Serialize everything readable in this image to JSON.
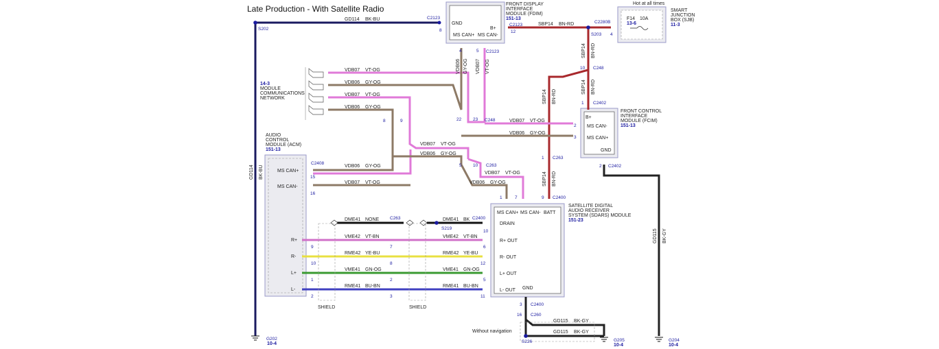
{
  "title": "Late Production - With Satellite Radio",
  "colors": {
    "vt_og": "#e07ad8",
    "gy_og": "#8d7a66",
    "bn_rd": "#a8282c",
    "bk_bu": "#1a1a60",
    "bk": "#111111",
    "vt_bn": "#d070c8",
    "ye_bu": "#e8e040",
    "gn_og": "#3a9a30",
    "bu_bn": "#4040c0",
    "bk_gy": "#222222"
  },
  "modules": {
    "fdim": {
      "name": "FRONT DISPLAY",
      "line2": "INTERFACE",
      "line3": "MODULE (FDIM)",
      "ref": "151-13",
      "pin_gnd": "GND",
      "pin_bplus": "B+",
      "pin_can_p": "MS CAN+",
      "pin_can_m": "MS CAN-"
    },
    "sjb": {
      "note": "Hot at all times",
      "name": "SMART",
      "line2": "JUNCTION",
      "line3": "BOX (SJB)",
      "ref": "11-3",
      "fuse": "F14",
      "amp": "10A",
      "fuse_ref": "13-6"
    },
    "fcim": {
      "name": "FRONT CONTROL",
      "line2": "INTERFACE",
      "line3": "MODULE (FCIM)",
      "ref": "151-13",
      "pin_bplus": "B+",
      "pin_can_m": "MS CAN-",
      "pin_can_p": "MS CAN+",
      "pin_gnd": "GND"
    },
    "acm": {
      "name": "AUDIO",
      "line2": "CONTROL",
      "line3": "MODULE (ACM)",
      "ref": "151-13",
      "pin_can_p": "MS CAN+",
      "pin_can_m": "MS CAN-",
      "pin_rp": "R+",
      "pin_rm": "R-",
      "pin_lp": "L+",
      "pin_lm": "L-"
    },
    "sdars": {
      "name": "SATELLITE DIGITAL",
      "line2": "AUDIO RECEIVER",
      "line3": "SYSTEM (SDARS) MODULE",
      "ref": "151-23",
      "pin_can_p": "MS CAN+",
      "pin_can_m": "MS CAN-",
      "pin_batt": "BATT",
      "pin_drain": "DRAIN",
      "pin_rp": "R+ OUT",
      "pin_rm": "R- OUT",
      "pin_lp": "L+ OUT",
      "pin_lm": "L- OUT",
      "pin_gnd": "GND"
    },
    "network": {
      "ref": "14-3",
      "line1": "MODULE",
      "line2": "COMMUNICATIONS",
      "line3": "NETWORK"
    }
  },
  "connectors": {
    "c2123a": "C2123",
    "c2123b": "C2123",
    "c2123c": "C2123",
    "c2280b": "C2280B",
    "c2248a": "C248",
    "c2402a": "C2402",
    "c2402b": "C2402",
    "c2248b": "C248",
    "c263a": "C263",
    "c263b": "C263",
    "c263c": "C263",
    "c2400a": "C2400",
    "c2400b": "C2400",
    "c2400c": "C2400",
    "c2400d": "C2400",
    "c2408": "C2408",
    "c260": "C260"
  },
  "splices": {
    "s202": "S202",
    "s203": "S203",
    "s219": "S219",
    "s226": "S226"
  },
  "grounds": {
    "g202": "G202",
    "g202_ref": "10-4",
    "g205": "G205",
    "g205_ref": "10-4",
    "g204": "G204",
    "g204_ref": "10-4"
  },
  "circuits": {
    "gd114": "GD114",
    "bk_bu": "BK-BU",
    "sbp14": "SBP14",
    "bn_rd": "BN-RD",
    "vdb07": "VDB07",
    "vt_og": "VT-OG",
    "vdb06": "VDB06",
    "gy_og": "GY-OG",
    "dme41": "DME41",
    "none": "NONE",
    "bk": "BK",
    "vme42": "VME42",
    "vt_bn": "VT-BN",
    "rme42": "RME42",
    "ye_bu": "YE-BU",
    "vme41": "VME41",
    "gn_og": "GN-OG",
    "rme41": "RME41",
    "bu_bn": "BU-BN",
    "gd115": "GD115",
    "bk_gy": "BK-GY"
  },
  "labels": {
    "shield": "SHIELD",
    "without_nav": "Without navigation"
  }
}
